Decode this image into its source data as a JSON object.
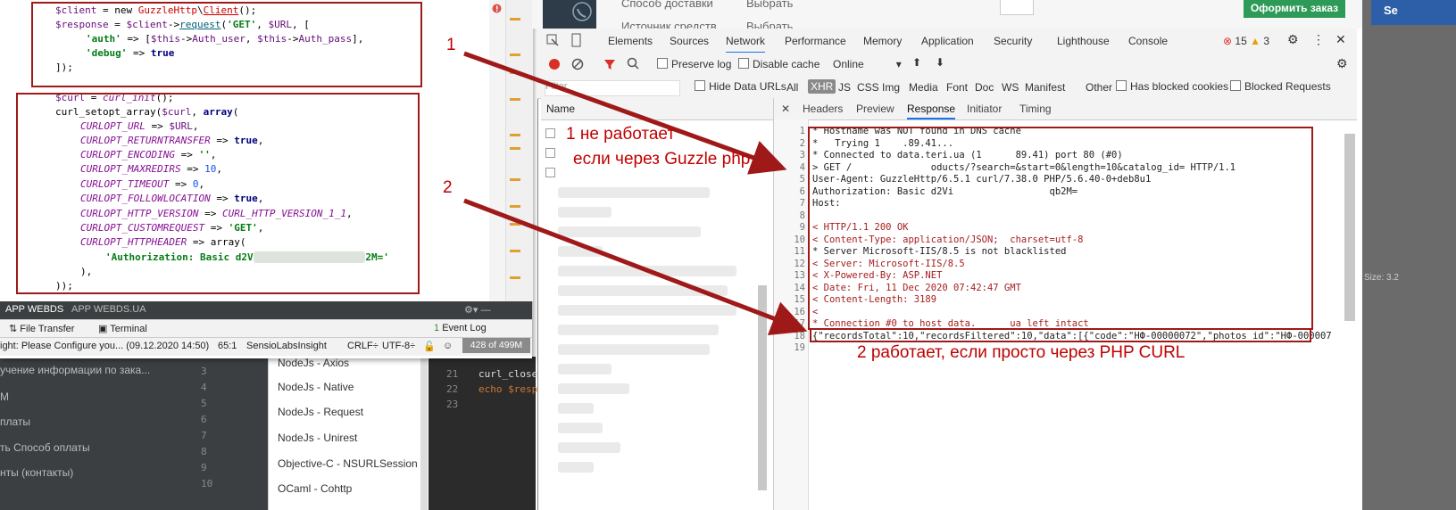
{
  "bg_menu": [
    "учение информации по зака...",
    "M",
    "платы",
    "ть Способ оплаты",
    "нты (контакты)"
  ],
  "bg_lines": [
    "3",
    "4",
    "5",
    "6",
    "7",
    "8",
    "9",
    "10"
  ],
  "snippets": [
    "NodeJs - Axios",
    "NodeJs - Native",
    "NodeJs - Request",
    "NodeJs - Unirest",
    "Objective-C - NSURLSession",
    "OCaml - Cohttp"
  ],
  "mid_editor": {
    "lines": [
      "21",
      "22",
      "23"
    ],
    "code": [
      "curl_close",
      "echo $resp",
      ""
    ]
  },
  "ide": {
    "code": {
      "l1_a": "$client",
      "l1_b": " = new ",
      "l1_c": "GuzzleHttp",
      "l1_d": "\\",
      "l1_e": "Client",
      "l1_f": "();",
      "l2_a": "$response",
      "l2_b": " = ",
      "l2_c": "$client",
      "l2_d": "->",
      "l2_e": "request",
      "l2_f": "(",
      "l2_g": "'GET'",
      "l2_h": ", ",
      "l2_i": "$URL",
      "l2_j": ", [",
      "l3_a": "'auth'",
      "l3_b": " => [",
      "l3_c": "$this",
      "l3_d": "->",
      "l3_e": "Auth_user",
      "l3_f": ", ",
      "l3_g": "$this",
      "l3_h": "->",
      "l3_i": "Auth_pass",
      "l3_j": "],",
      "l4_a": "'debug'",
      "l4_b": " => ",
      "l4_c": "true",
      "l5": "]);",
      "l6_a": "$curl",
      "l6_b": " = ",
      "l6_c": "curl_init",
      "l6_d": "();",
      "l7_a": "curl_setopt_array",
      "l7_b": "(",
      "l7_c": "$curl",
      "l7_d": ", ",
      "l7_e": "array",
      "l7_f": "(",
      "c1": "CURLOPT_URL",
      "c1v": "$URL",
      "c2": "CURLOPT_RETURNTRANSFER",
      "c2v": "true",
      "c3": "CURLOPT_ENCODING",
      "c3v": "''",
      "c4": "CURLOPT_MAXREDIRS",
      "c4v": "10",
      "c5": "CURLOPT_TIMEOUT",
      "c5v": "0",
      "c6": "CURLOPT_FOLLOWLOCATION",
      "c6v": "true",
      "c7": "CURLOPT_HTTP_VERSION",
      "c7v": "CURL_HTTP_VERSION_1_1",
      "c8": "CURLOPT_CUSTOMREQUEST",
      "c8v": "'GET'",
      "c9": "CURLOPT_HTTPHEADER",
      "c9v": "array(",
      "auth_a": "'Authorization: Basic d2V",
      "auth_b": "2M='",
      "close1": "),",
      "close2": "));"
    },
    "tabs": [
      "APP WEBDS",
      "APP WEBDS.UA"
    ],
    "tools": {
      "file_transfer": "File Transfer",
      "terminal": "Terminal",
      "event_log": "Event Log",
      "event_count": "1"
    },
    "status": {
      "insight": "ight: Please Configure you... (09.12.2020 14:50)",
      "pos": "65:1",
      "plugin": "SensioLabsInsight",
      "crlf": "CRLF÷",
      "enc": "UTF-8÷",
      "mem": "428 of 499M"
    }
  },
  "site": {
    "t1": "Способ доставки",
    "t2": "Выбрать",
    "t3": "Источник средств",
    "t4": "Выбрать",
    "btn": "Оформить заказ"
  },
  "devtools": {
    "tabs": [
      "Elements",
      "Sources",
      "Network",
      "Performance",
      "Memory",
      "Application",
      "Security",
      "Lighthouse",
      "Console"
    ],
    "errors": "15",
    "warnings": "3",
    "row2": {
      "preserve": "Preserve log",
      "disable": "Disable cache",
      "throttle": "Online"
    },
    "row3": {
      "filter_placeholder": "Filter",
      "hide_data": "Hide Data URLs",
      "types": [
        "All",
        "XHR",
        "JS",
        "CSS",
        "Img",
        "Media",
        "Font",
        "Doc",
        "WS",
        "Manifest",
        "Other"
      ],
      "blocked_cookies": "Has blocked cookies",
      "blocked_req": "Blocked Requests"
    },
    "name_header": "Name",
    "resp_tabs": [
      "Headers",
      "Preview",
      "Response",
      "Initiator",
      "Timing"
    ],
    "resp_lines": [
      "* Hostname was NOT found in DNS cache",
      "*   Trying 1    .89.41...",
      "* Connected to data.teri.ua (1      89.41) port 80 (#0)",
      "> GET /              oducts/?search=&start=0&length=10&catalog_id= HTTP/1.1",
      "User-Agent: GuzzleHttp/6.5.1 curl/7.38.0 PHP/5.6.40-0+deb8u1",
      "Authorization: Basic d2Vi                 qb2M=",
      "Host:",
      "",
      "< HTTP/1.1 200 OK",
      "< Content-Type: application/JSON;  charset=utf-8",
      "* Server Microsoft-IIS/8.5 is not blacklisted",
      "< Server: Microsoft-IIS/8.5",
      "< X-Powered-By: ASP.NET",
      "< Date: Fri, 11 Dec 2020 07:42:47 GMT",
      "< Content-Length: 3189",
      "<",
      "* Connection #0 to host data.      ua left intact",
      "{\"recordsTotal\":10,\"recordsFiltered\":10,\"data\":[{\"code\":\"НФ-00000072\",\"photos_id\":\"НФ-000007",
      ""
    ],
    "resp_nums": [
      "1",
      "2",
      "3",
      "4",
      "5",
      "6",
      "7",
      "8",
      "9",
      "10",
      "11",
      "12",
      "13",
      "14",
      "15",
      "16",
      "17",
      "18",
      "19"
    ]
  },
  "annotations": {
    "n1": "1",
    "n2": "2",
    "t1a": "1 не работает",
    "t1b": "если через Guzzle php",
    "t2": "2 работает, если просто через PHP CURL"
  },
  "right_edge": {
    "top": "Se",
    "mid": "Size: 3.2"
  }
}
